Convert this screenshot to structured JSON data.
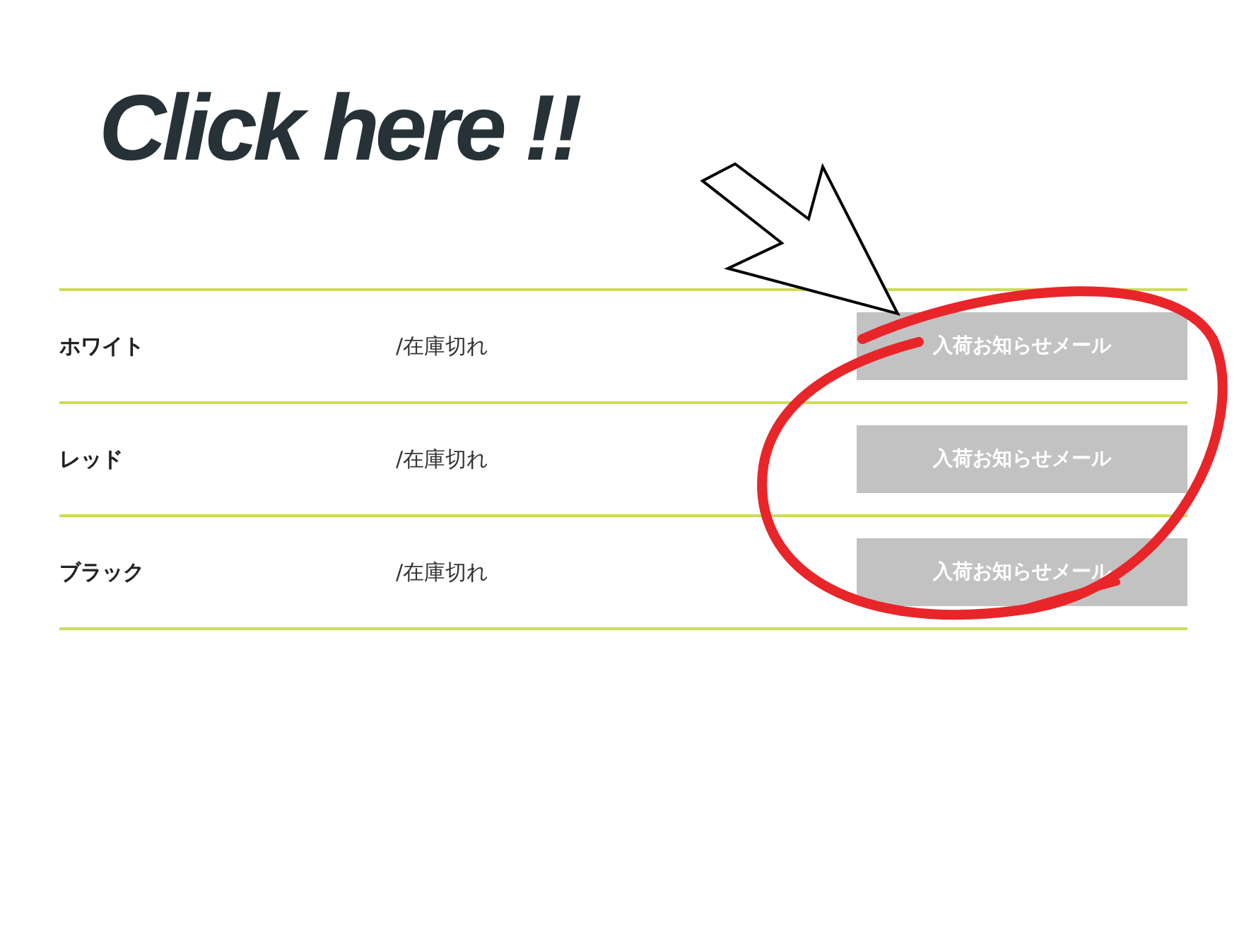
{
  "heading": "Click here !!",
  "rows": [
    {
      "name": "ホワイト",
      "stock": "/在庫切れ",
      "button": "入荷お知らせメール"
    },
    {
      "name": "レッド",
      "stock": "/在庫切れ",
      "button": "入荷お知らせメール"
    },
    {
      "name": "ブラック",
      "stock": "/在庫切れ",
      "button": "入荷お知らせメール"
    }
  ]
}
